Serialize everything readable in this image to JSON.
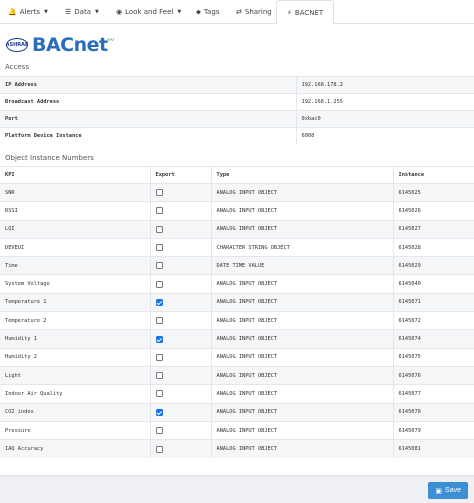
{
  "tabs": [
    {
      "label": "Alerts",
      "icon": "bell-icon",
      "glyph": "🔔",
      "dropdown": true
    },
    {
      "label": "Data",
      "icon": "list-icon",
      "glyph": "☰",
      "dropdown": true
    },
    {
      "label": "Look and Feel",
      "icon": "eye-icon",
      "glyph": "◉",
      "dropdown": true
    },
    {
      "label": "Tags",
      "icon": "tag-icon",
      "glyph": "⬥",
      "dropdown": false
    },
    {
      "label": "Sharing",
      "icon": "share-icon",
      "glyph": "⇄",
      "dropdown": false
    },
    {
      "label": "BACNET",
      "icon": "bolt-icon",
      "glyph": "⚡",
      "dropdown": false,
      "active": true
    }
  ],
  "logo": {
    "badge": "ASHRAE",
    "word": "BACnet"
  },
  "access": {
    "title": "Access",
    "rows": [
      {
        "key": "IP Address",
        "value": "192.168.178.2"
      },
      {
        "key": "Broadcast Address",
        "value": "192.168.1.255"
      },
      {
        "key": "Port",
        "value": "0xbac0"
      },
      {
        "key": "Platform Device Instance",
        "value": "6008"
      }
    ]
  },
  "objects": {
    "title": "Object Instance Numbers",
    "headers": {
      "kpi": "KPI",
      "export": "Export",
      "type": "Type",
      "instance": "Instance"
    },
    "rows": [
      {
        "kpi": "SNR",
        "export": false,
        "type": "ANALOG INPUT OBJECT",
        "instance": "6145025"
      },
      {
        "kpi": "RSSI",
        "export": false,
        "type": "ANALOG INPUT OBJECT",
        "instance": "6145026"
      },
      {
        "kpi": "LQI",
        "export": false,
        "type": "ANALOG INPUT OBJECT",
        "instance": "6145027"
      },
      {
        "kpi": "DEVEUI",
        "export": false,
        "type": "CHARACTER STRING OBJECT",
        "instance": "6145028"
      },
      {
        "kpi": "Time",
        "export": false,
        "type": "DATE TIME VALUE",
        "instance": "6145029"
      },
      {
        "kpi": "System Voltage",
        "export": false,
        "type": "ANALOG INPUT OBJECT",
        "instance": "6145040"
      },
      {
        "kpi": "Temperature 1",
        "export": true,
        "type": "ANALOG INPUT OBJECT",
        "instance": "6145071"
      },
      {
        "kpi": "Temperature 2",
        "export": false,
        "type": "ANALOG INPUT OBJECT",
        "instance": "6145072"
      },
      {
        "kpi": "Humidity 1",
        "export": true,
        "type": "ANALOG INPUT OBJECT",
        "instance": "6145074"
      },
      {
        "kpi": "Humidity 2",
        "export": false,
        "type": "ANALOG INPUT OBJECT",
        "instance": "6145075"
      },
      {
        "kpi": "Light",
        "export": false,
        "type": "ANALOG INPUT OBJECT",
        "instance": "6145076"
      },
      {
        "kpi": "Indoor Air Quality",
        "export": false,
        "type": "ANALOG INPUT OBJECT",
        "instance": "6145077"
      },
      {
        "kpi": "CO2 index",
        "export": true,
        "type": "ANALOG INPUT OBJECT",
        "instance": "6145078"
      },
      {
        "kpi": "Pressure",
        "export": false,
        "type": "ANALOG INPUT OBJECT",
        "instance": "6145079"
      },
      {
        "kpi": "IAQ Accuracy",
        "export": false,
        "type": "ANALOG INPUT OBJECT",
        "instance": "6145081"
      }
    ]
  },
  "footer": {
    "save_label": "Save",
    "save_icon": "save-icon",
    "save_glyph": "▣"
  },
  "colors": {
    "accent": "#1a73e8",
    "save_button": "#3c8fd5",
    "brand_blue": "#2a6ebb"
  }
}
